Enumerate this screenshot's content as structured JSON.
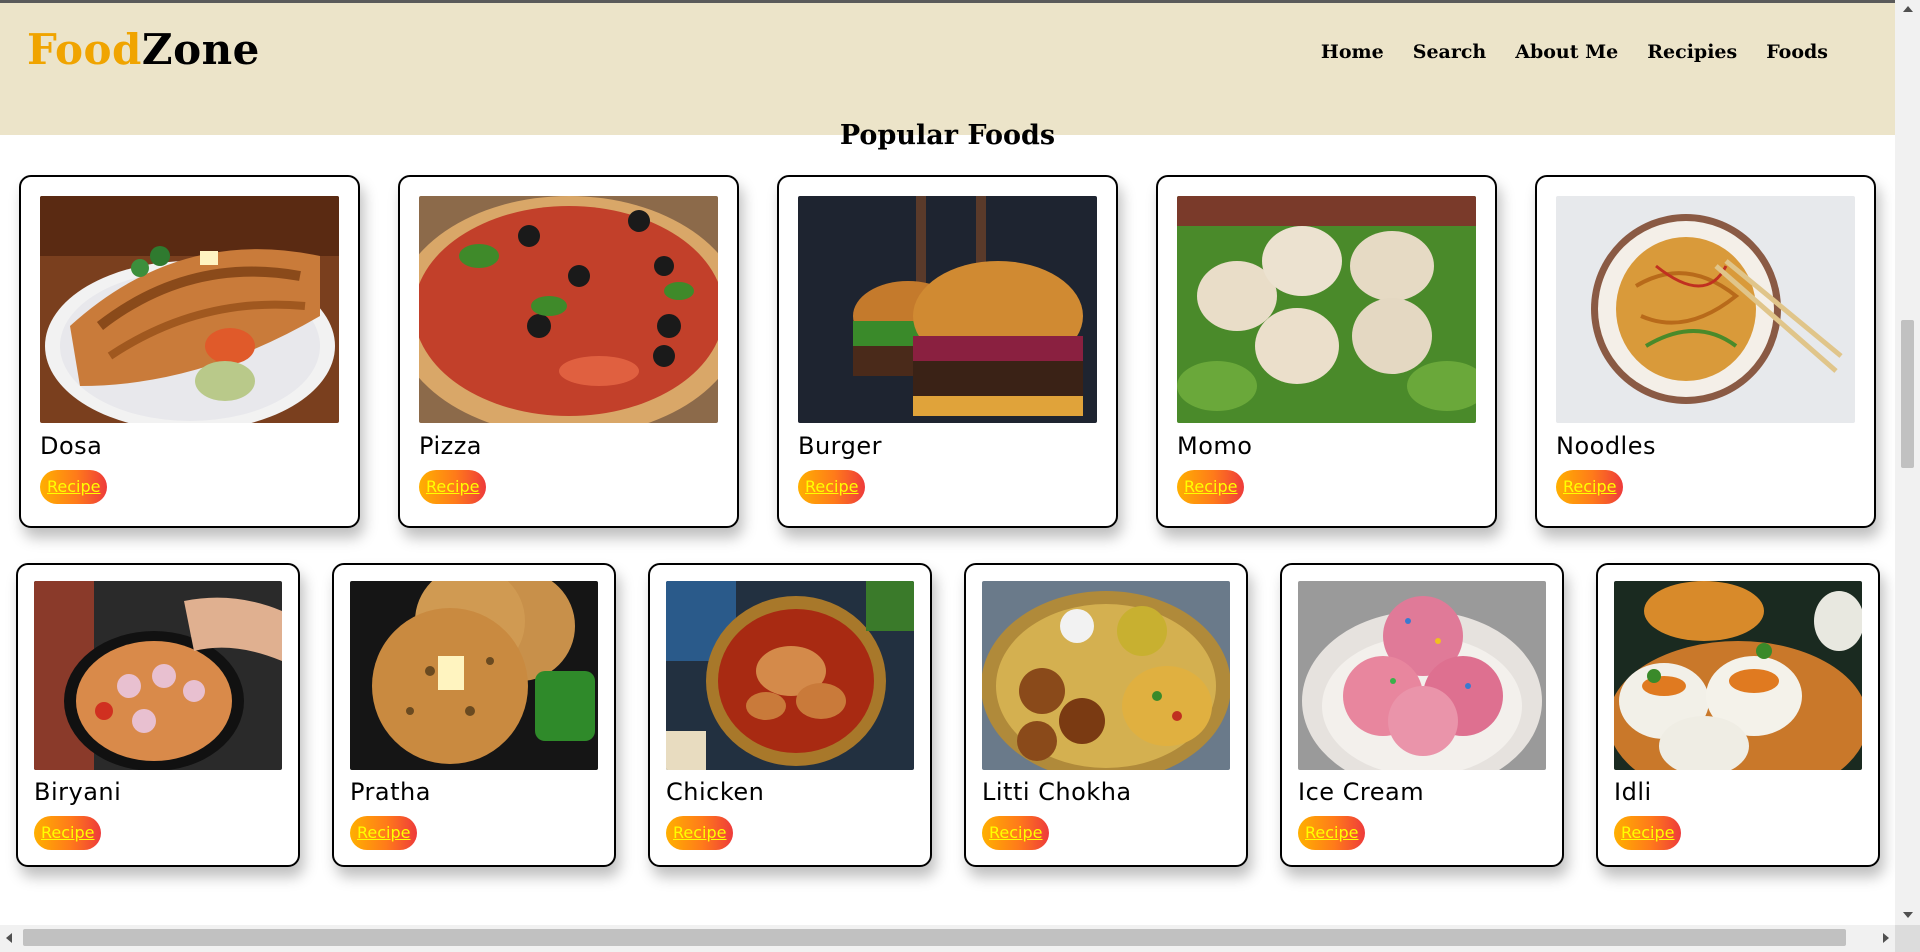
{
  "header": {
    "logo_part1": "Food",
    "logo_part2": "Zone",
    "nav": [
      "Home",
      "Search",
      "About Me",
      "Recipies",
      "Foods"
    ]
  },
  "section_title": "Popular Foods",
  "button_label": "Recipe",
  "colors": {
    "header_bg": "#ece4c9",
    "logo_accent": "#f0a400",
    "button_gradient_start": "#ffb000",
    "button_gradient_end": "#ee3b3b",
    "button_text": "#ffff00"
  },
  "foods_row1": [
    {
      "name": "Dosa",
      "image": "dosa-image"
    },
    {
      "name": "Pizza",
      "image": "pizza-image"
    },
    {
      "name": "Burger",
      "image": "burger-image"
    },
    {
      "name": "Momo",
      "image": "momo-image"
    },
    {
      "name": "Noodles",
      "image": "noodles-image"
    }
  ],
  "foods_row2": [
    {
      "name": "Biryani",
      "image": "biryani-image"
    },
    {
      "name": "Pratha",
      "image": "pratha-image"
    },
    {
      "name": "Chicken",
      "image": "chicken-image"
    },
    {
      "name": "Litti Chokha",
      "image": "litti-chokha-image"
    },
    {
      "name": "Ice Cream",
      "image": "ice-cream-image"
    },
    {
      "name": "Idli",
      "image": "idli-image"
    }
  ]
}
